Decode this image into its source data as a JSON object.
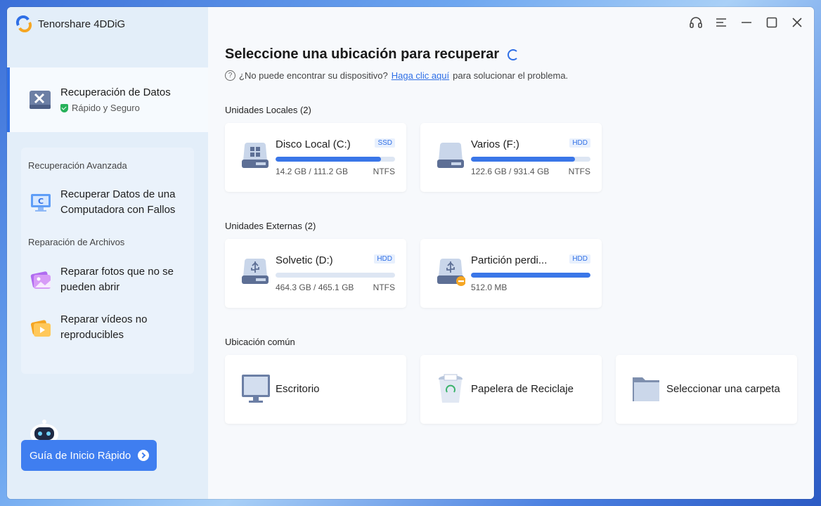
{
  "app": {
    "title": "Tenorshare 4DDiG"
  },
  "sidebar": {
    "main_item": {
      "title": "Recuperación de Datos",
      "subtitle": "Rápido y Seguro"
    },
    "sections": [
      {
        "title": "Recuperación Avanzada",
        "items": [
          {
            "label_line1": "Recuperar Datos de una",
            "label_line2": "Computadora con Fallos",
            "icon": "computer-recovery-icon"
          }
        ]
      },
      {
        "title": "Reparación de Archivos",
        "items": [
          {
            "label_line1": "Reparar fotos que no se",
            "label_line2": "pueden abrir",
            "icon": "photo-repair-icon"
          },
          {
            "label_line1": "Reparar vídeos no",
            "label_line2": "reproducibles",
            "icon": "video-repair-icon"
          }
        ]
      }
    ],
    "guide_button": "Guía de Inicio Rápido"
  },
  "main": {
    "title": "Seleccione una ubicación para recuperar",
    "hint_prefix": "¿No puede encontrar su dispositivo?",
    "hint_link": "Haga clic aquí",
    "hint_suffix": "para solucionar el problema.",
    "local_title": "Unidades Locales (2)",
    "local_drives": [
      {
        "name": "Disco Local (C:)",
        "type": "SSD",
        "size": "14.2 GB / 111.2 GB",
        "fs": "NTFS",
        "usage": 0.88
      },
      {
        "name": "Varios (F:)",
        "type": "HDD",
        "size": "122.6 GB / 931.4 GB",
        "fs": "NTFS",
        "usage": 0.87
      }
    ],
    "external_title": "Unidades Externas (2)",
    "external_drives": [
      {
        "name": "Solvetic (D:)",
        "type": "HDD",
        "size": "464.3 GB / 465.1 GB",
        "fs": "NTFS",
        "usage": 0.0
      },
      {
        "name": "Partición perdi...",
        "type": "HDD",
        "size": "512.0 MB",
        "fs": "",
        "usage": 1.0
      }
    ],
    "common_title": "Ubicación común",
    "common": [
      {
        "label": "Escritorio"
      },
      {
        "label": "Papelera de Reciclaje"
      },
      {
        "label": "Seleccionar una carpeta"
      }
    ]
  },
  "colors": {
    "accent": "#2f6fe6",
    "bar": "#3a76e8",
    "success": "#27b15a"
  }
}
